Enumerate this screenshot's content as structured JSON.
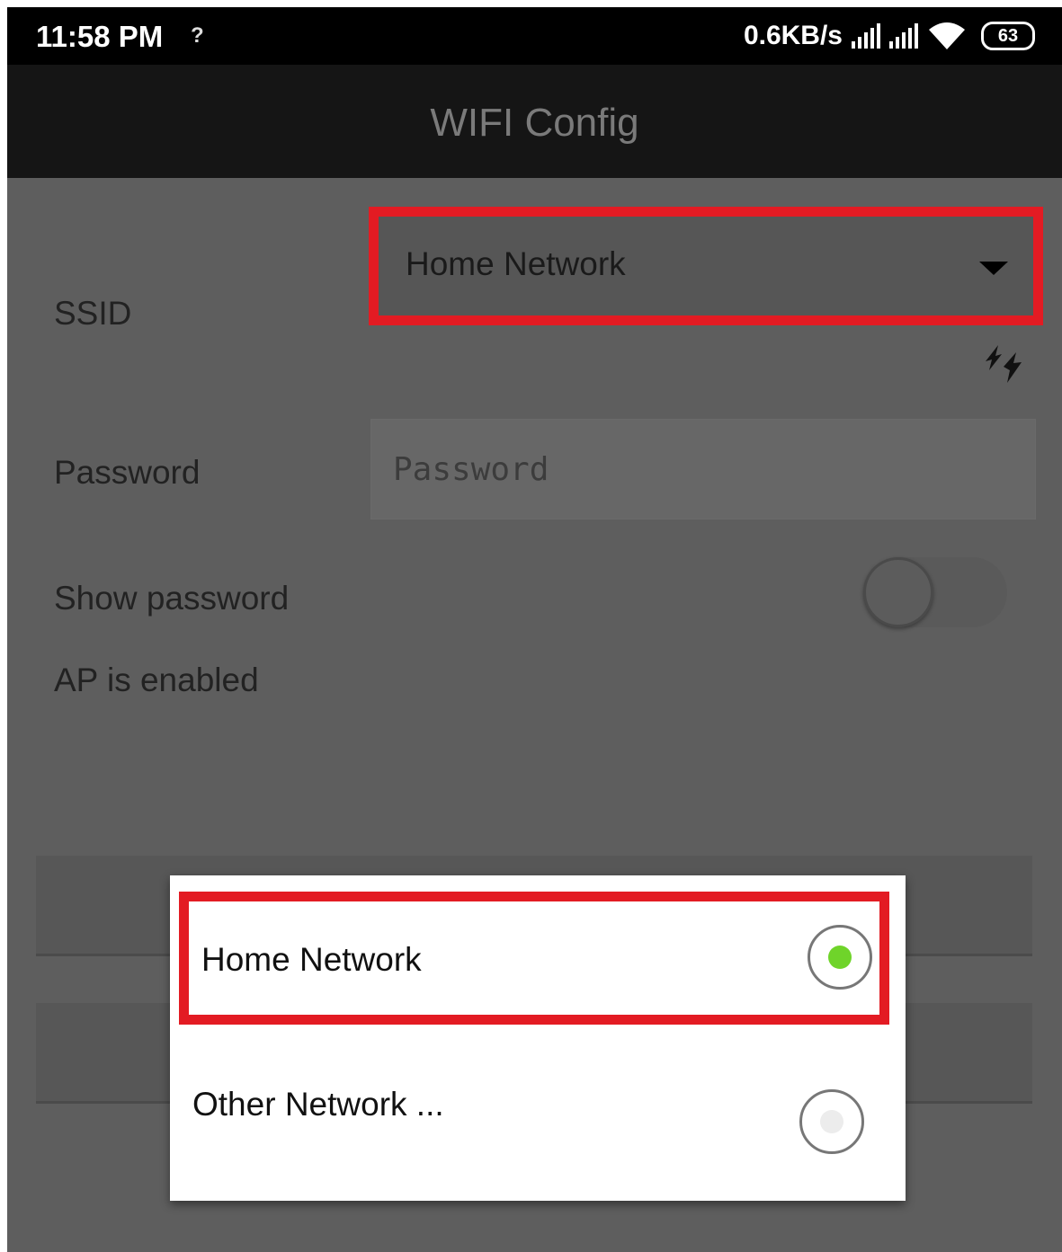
{
  "status_bar": {
    "time": "11:58 PM",
    "unknown_indicator": "?",
    "net_speed": "0.6KB/s",
    "battery": "63"
  },
  "app_bar": {
    "title": "WIFI Config"
  },
  "form": {
    "ssid_label": "SSID",
    "ssid_selected": "Home Network",
    "password_label": "Password",
    "password_placeholder": "Password",
    "password_value": "",
    "show_password_label": "Show password",
    "show_password_on": false,
    "status_text": "AP is enabled"
  },
  "dialog": {
    "options": [
      {
        "label": "Home Network",
        "selected": true
      },
      {
        "label": "Other Network ...",
        "selected": false
      }
    ]
  },
  "colors": {
    "highlight": "#e31b23",
    "radio_selected": "#6fd42a"
  }
}
